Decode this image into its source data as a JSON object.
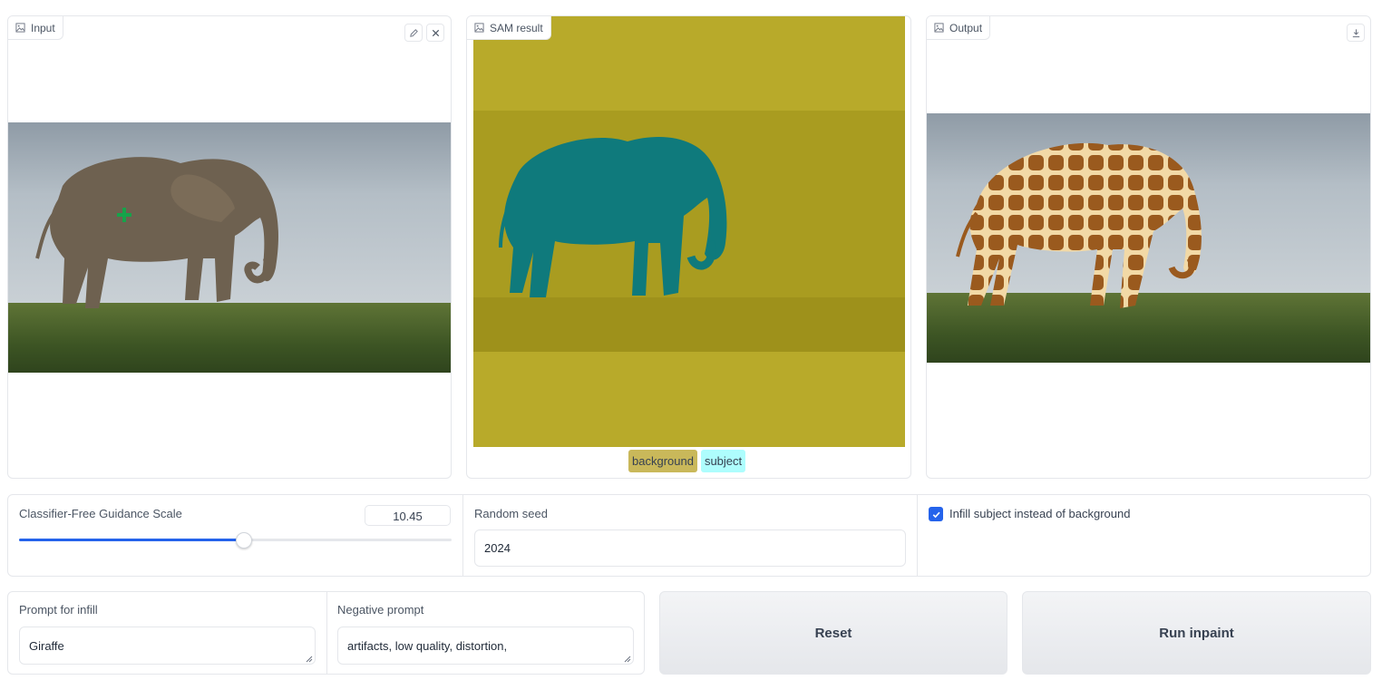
{
  "input_panel": {
    "label": "Input",
    "icon": "image-icon",
    "edit_icon": "pencil-icon",
    "clear_icon": "close-icon"
  },
  "sam_panel": {
    "label": "SAM result",
    "icon": "image-icon",
    "legend": [
      {
        "label": "background",
        "color": "#c9b85a"
      },
      {
        "label": "subject",
        "color": "#aefdfd"
      }
    ]
  },
  "output_panel": {
    "label": "Output",
    "icon": "image-icon",
    "download_icon": "download-icon"
  },
  "controls": {
    "cfg_label": "Classifier-Free Guidance Scale",
    "cfg_value": "10.45",
    "cfg_fraction": 0.52,
    "seed_label": "Random seed",
    "seed_value": "2024",
    "infill_checkbox_label": "Infill subject instead of background",
    "infill_checked": true
  },
  "prompts": {
    "infill_label": "Prompt for infill",
    "infill_value": "Giraffe",
    "negative_label": "Negative prompt",
    "negative_value": "artifacts, low quality, distortion,"
  },
  "buttons": {
    "reset": "Reset",
    "run": "Run inpaint"
  },
  "colors": {
    "accent": "#2563eb",
    "mask_bg": "#b8aa2a",
    "mask_subject": "#0f7a7c"
  }
}
